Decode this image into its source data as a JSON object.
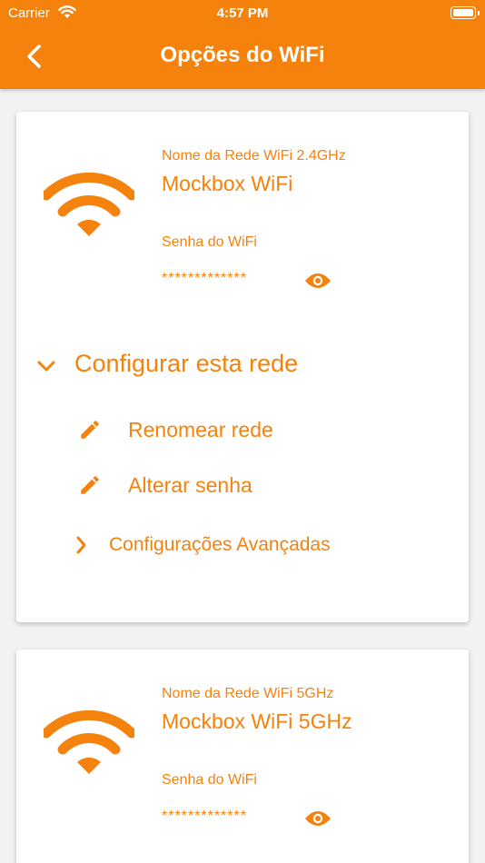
{
  "status_bar": {
    "carrier": "Carrier",
    "time": "4:57 PM"
  },
  "header": {
    "title": "Opções do WiFi",
    "back_icon": "chevron-left-icon"
  },
  "colors": {
    "accent": "#f5820d",
    "background": "#f2f2f2",
    "card": "#ffffff"
  },
  "networks": [
    {
      "name_label": "Nome da Rede WiFi 2.4GHz",
      "name": "Mockbox WiFi",
      "password_label": "Senha do WiFi",
      "password_masked": "*************"
    },
    {
      "name_label": "Nome da Rede WiFi 5GHz",
      "name": "Mockbox WiFi 5GHz",
      "password_label": "Senha do WiFi",
      "password_masked": "*************"
    }
  ],
  "configure": {
    "label": "Configurar esta rede",
    "actions": [
      {
        "label": "Renomear rede",
        "icon": "pencil-icon"
      },
      {
        "label": "Alterar senha",
        "icon": "pencil-icon"
      }
    ],
    "advanced_label": "Configurações Avançadas"
  }
}
